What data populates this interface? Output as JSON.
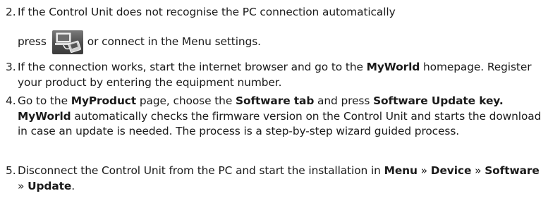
{
  "steps": [
    {
      "num": "2.",
      "line1": "If the Control Unit does not recognise the PC connection automatically",
      "press_before": "press",
      "press_after": "or connect in the Menu settings.",
      "icon": "pc-connection-icon"
    },
    {
      "num": "3.",
      "t1": "If the connection works, start the internet browser and go to the ",
      "b1": "MyWorld",
      "t2": " homepage. Register your product by entering the equipment number."
    },
    {
      "num": "4.",
      "t1": "Go to the ",
      "b1": "MyProduct",
      "t2": " page, choose the ",
      "b2": "Software tab",
      "t3": " and press ",
      "b3": "Software Update key. MyWorld",
      "t4": " automatically checks the firmware version on the Control Unit and starts the download in case an update is needed. The process is a step-by-step wizard guided process."
    },
    {
      "num": "5.",
      "t1": "Disconnect the Control Unit from the PC and start the installation in ",
      "b1": "Menu",
      "sep1": " » ",
      "b2": "Device",
      "sep2": " » ",
      "b3": "Software",
      "sep3": " » ",
      "b4": "Update",
      "t2": "."
    }
  ]
}
